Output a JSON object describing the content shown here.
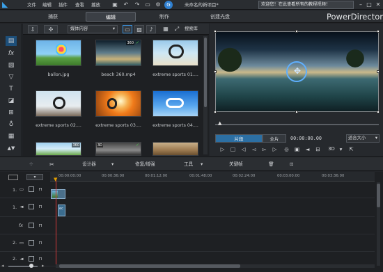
{
  "menubar": {
    "items": [
      "文件",
      "编辑",
      "插件",
      "查看",
      "播放"
    ],
    "project_name": "未命名的新项目*",
    "welcome": "欢迎您！在此查看所有的教程视频！",
    "icons": [
      "save-icon",
      "undo-icon",
      "redo-icon",
      "settings-icon",
      "account-icon"
    ]
  },
  "modes": {
    "capture": "捕获",
    "edit": "编辑",
    "produce": "制作",
    "disc": "创建光盘",
    "brand": "PowerDirector"
  },
  "library": {
    "media_dropdown": "媒体内容",
    "search": "搜索库",
    "items": [
      {
        "label": "ballon.jpg",
        "badge": ""
      },
      {
        "label": "beach 360.mp4",
        "badge": "360"
      },
      {
        "label": "extreme sports 01....",
        "badge": ""
      },
      {
        "label": "extreme sports 02....",
        "badge": ""
      },
      {
        "label": "extreme sports 03....",
        "badge": ""
      },
      {
        "label": "extreme sports 04....",
        "badge": ""
      }
    ],
    "row3_badges": [
      "360",
      "3D",
      ""
    ]
  },
  "preview": {
    "clip_label": "片段",
    "movie_label": "全片",
    "timecode": "00:00:00.00",
    "fit_label": "适合大小",
    "mode3d": "3D"
  },
  "toolbar": {
    "designer": "设计器",
    "fix_enhance": "修复/增强",
    "tools": "工具",
    "keyframe": "关键帧"
  },
  "timeline": {
    "ticks": [
      "00:00:00:00",
      "00:00:36:00",
      "00:01:12:00",
      "00:01:48:00",
      "00:02:24:00",
      "00:03:00:00",
      "00:03:36:00"
    ],
    "tracks": [
      {
        "num": "1.",
        "kind": "video"
      },
      {
        "num": "1.",
        "kind": "audio"
      },
      {
        "num": "",
        "kind": "fx"
      },
      {
        "num": "2.",
        "kind": "video"
      },
      {
        "num": "2.",
        "kind": "audio"
      }
    ],
    "audio_clip_label": "ec"
  }
}
